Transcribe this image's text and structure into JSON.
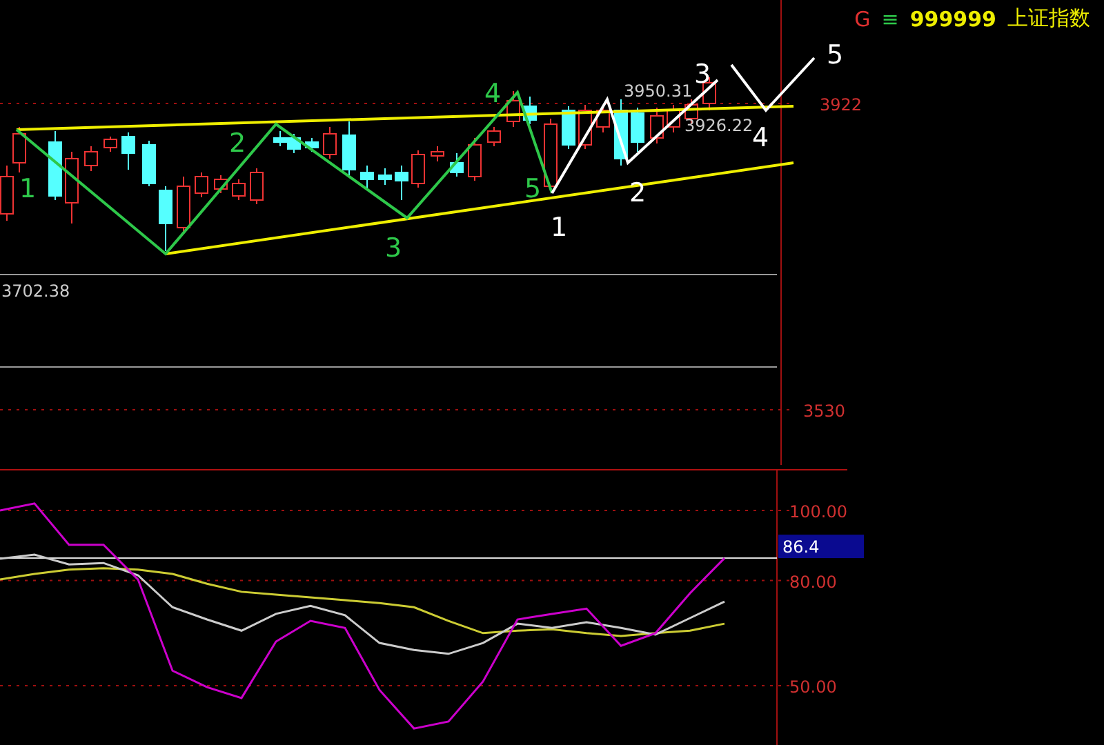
{
  "header": {
    "letter": "G",
    "menu_glyph": "≡",
    "code": "999999",
    "name": "上证指数"
  },
  "price_axis": [
    "3922",
    "3530"
  ],
  "price_marks": {
    "high": "3950.31",
    "last": "3926.22",
    "low": "3702.38"
  },
  "wave_sets": [
    {
      "color": "#2ec84a",
      "labels": [
        "1",
        "2",
        "3",
        "4",
        "5"
      ]
    },
    {
      "color": "#ffffff",
      "labels": [
        "1",
        "2",
        "3",
        "4",
        "5"
      ]
    }
  ],
  "oscillator": {
    "chart_data": {
      "type": "line",
      "grid": true,
      "ref_lines": [
        {
          "axis": "y",
          "value": 86.4,
          "label": "86.4",
          "color": "#dddddd"
        }
      ],
      "ylim": [
        33.1,
        111.4
      ],
      "yticks": [
        {
          "value": 100,
          "label": "100.00"
        },
        {
          "value": 80,
          "label": "80.00"
        },
        {
          "value": 50,
          "label": "50.00"
        }
      ],
      "series": [
        {
          "color": "#cccc33",
          "values": [
            80.3,
            81.9,
            83.1,
            83.5,
            83.1,
            81.9,
            79.1,
            76.8,
            76.0,
            75.2,
            74.4,
            73.6,
            72.4,
            68.5,
            65.0,
            65.7,
            66.1,
            65.0,
            64.2,
            65.0,
            65.7,
            67.7
          ]
        },
        {
          "color": "#cccccc",
          "values": [
            86.2,
            87.4,
            84.6,
            85.0,
            81.5,
            72.4,
            68.9,
            65.7,
            70.5,
            72.8,
            70.1,
            62.2,
            60.2,
            59.1,
            62.2,
            67.7,
            66.5,
            68.1,
            66.5,
            64.6,
            69.3,
            74.0
          ]
        },
        {
          "color": "#cc00cc",
          "values": [
            100,
            102,
            90.2,
            90.2,
            80.3,
            54.3,
            49.6,
            46.5,
            62.6,
            68.5,
            66.5,
            48.8,
            37.8,
            39.8,
            51.2,
            68.9,
            70.5,
            72.0,
            61.4,
            65.0,
            76.4,
            86.4
          ]
        }
      ]
    }
  }
}
